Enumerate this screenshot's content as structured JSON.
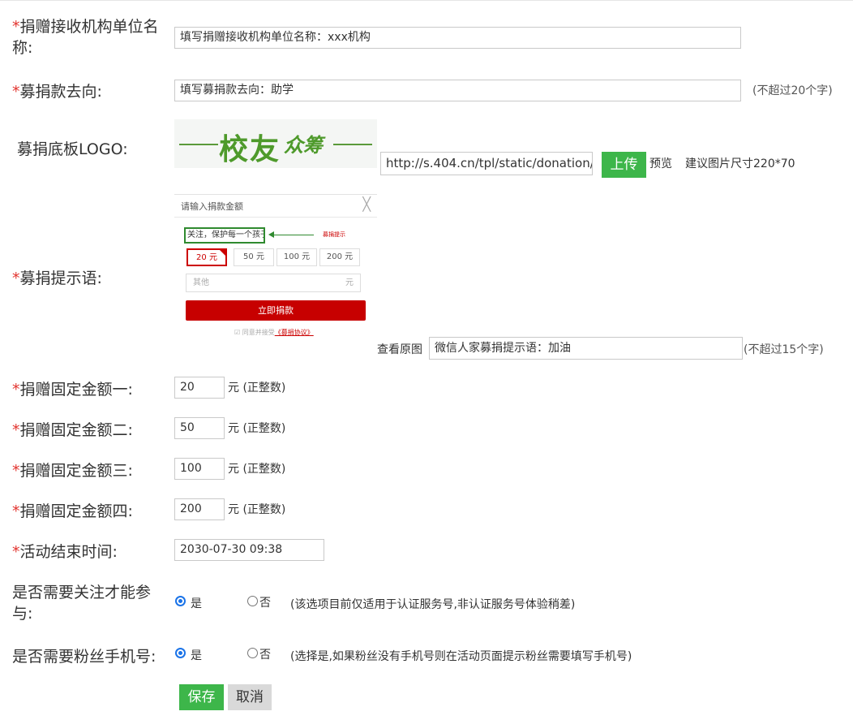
{
  "form": {
    "org_name": {
      "star": "*",
      "label_line1": "捐赠接收机构单位名",
      "label_line2": "称:",
      "value": "填写捐赠接收机构单位名称：xxx机构"
    },
    "destination": {
      "star": "*",
      "label": "募捐款去向:",
      "value": "填写募捐款去向：助学",
      "hint": "(不超过20个字)"
    },
    "logo": {
      "label": "募捐底板LOGO:",
      "logo_text_main": "校友",
      "logo_text_sub": "众筹",
      "url": "http://s.404.cn/tpl/static/donation/",
      "upload_label": "上传",
      "preview_label": "预览",
      "size_hint": "建议图片尺寸220*70"
    },
    "prompt": {
      "star": "*",
      "label": "募捐提示语:",
      "view_original": "查看原图",
      "value": "微信人家募捐提示语：加油",
      "hint": "(不超过15个字)",
      "preview": {
        "title": "请输入捐款金额",
        "close": "╳",
        "tip_text": "关注，保护每一个孩子",
        "tip_note": "募捐提示",
        "amounts": [
          "20 元",
          "50 元",
          "100 元",
          "200 元"
        ],
        "other_placeholder": "其他",
        "other_unit": "元",
        "donate_button": "立即捐款",
        "agree_text": "同意并接受",
        "agree_link": "《募捐协议》"
      }
    },
    "amount1": {
      "star": "*",
      "label": "捐赠固定金额一:",
      "value": "20",
      "unit": "元 (正整数)"
    },
    "amount2": {
      "star": "*",
      "label": "捐赠固定金额二:",
      "value": "50",
      "unit": "元 (正整数)"
    },
    "amount3": {
      "star": "*",
      "label": "捐赠固定金额三:",
      "value": "100",
      "unit": "元 (正整数)"
    },
    "amount4": {
      "star": "*",
      "label": "捐赠固定金额四:",
      "value": "200",
      "unit": "元 (正整数)"
    },
    "end_time": {
      "star": "*",
      "label": "活动结束时间:",
      "value": "2030-07-30 09:38"
    },
    "follow": {
      "label_line1": "是否需要关注才能参",
      "label_line2": "与:",
      "yes": "是",
      "no": "否",
      "selected": "yes",
      "note": "(该选项目前仅适用于认证服务号,非认证服务号体验稍差)"
    },
    "phone": {
      "label": "是否需要粉丝手机号:",
      "yes": "是",
      "no": "否",
      "selected": "yes",
      "note": "(选择是,如果粉丝没有手机号则在活动页面提示粉丝需要填写手机号)"
    }
  },
  "actions": {
    "save": "保存",
    "cancel": "取消"
  },
  "colors": {
    "accent_green": "#3db64a",
    "required_star": "#e2332e",
    "donate_red": "#c70000",
    "radio_blue": "#1a73e8"
  }
}
